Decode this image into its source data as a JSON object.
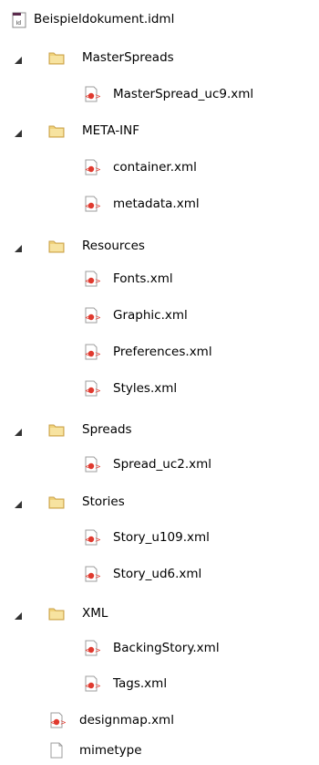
{
  "colors": {
    "folder_main": "#f0d27a",
    "folder_dark": "#d7a93b",
    "xml_red": "#e03a2f",
    "arrow": "#333333"
  },
  "tree": {
    "root": {
      "label": "Beispieldokument.idml",
      "icon": "idml-file-icon"
    },
    "items": [
      {
        "type": "folder",
        "label": "MasterSpreads",
        "expanded": true,
        "children": [
          {
            "label": "MasterSpread_uc9.xml"
          }
        ]
      },
      {
        "type": "folder",
        "label": "META-INF",
        "expanded": true,
        "children": [
          {
            "label": "container.xml"
          },
          {
            "label": "metadata.xml"
          }
        ]
      },
      {
        "type": "folder",
        "label": "Resources",
        "expanded": true,
        "children": [
          {
            "label": "Fonts.xml"
          },
          {
            "label": "Graphic.xml"
          },
          {
            "label": "Preferences.xml"
          },
          {
            "label": "Styles.xml"
          }
        ]
      },
      {
        "type": "folder",
        "label": "Spreads",
        "expanded": true,
        "children": [
          {
            "label": "Spread_uc2.xml"
          }
        ]
      },
      {
        "type": "folder",
        "label": "Stories",
        "expanded": true,
        "children": [
          {
            "label": "Story_u109.xml"
          },
          {
            "label": "Story_ud6.xml"
          }
        ]
      },
      {
        "type": "folder",
        "label": "XML",
        "expanded": true,
        "children": [
          {
            "label": "BackingStory.xml"
          },
          {
            "label": "Tags.xml"
          }
        ]
      }
    ],
    "files": [
      {
        "label": "designmap.xml",
        "icon": "xml-file-icon"
      },
      {
        "label": "mimetype",
        "icon": "blank-file-icon"
      }
    ]
  }
}
